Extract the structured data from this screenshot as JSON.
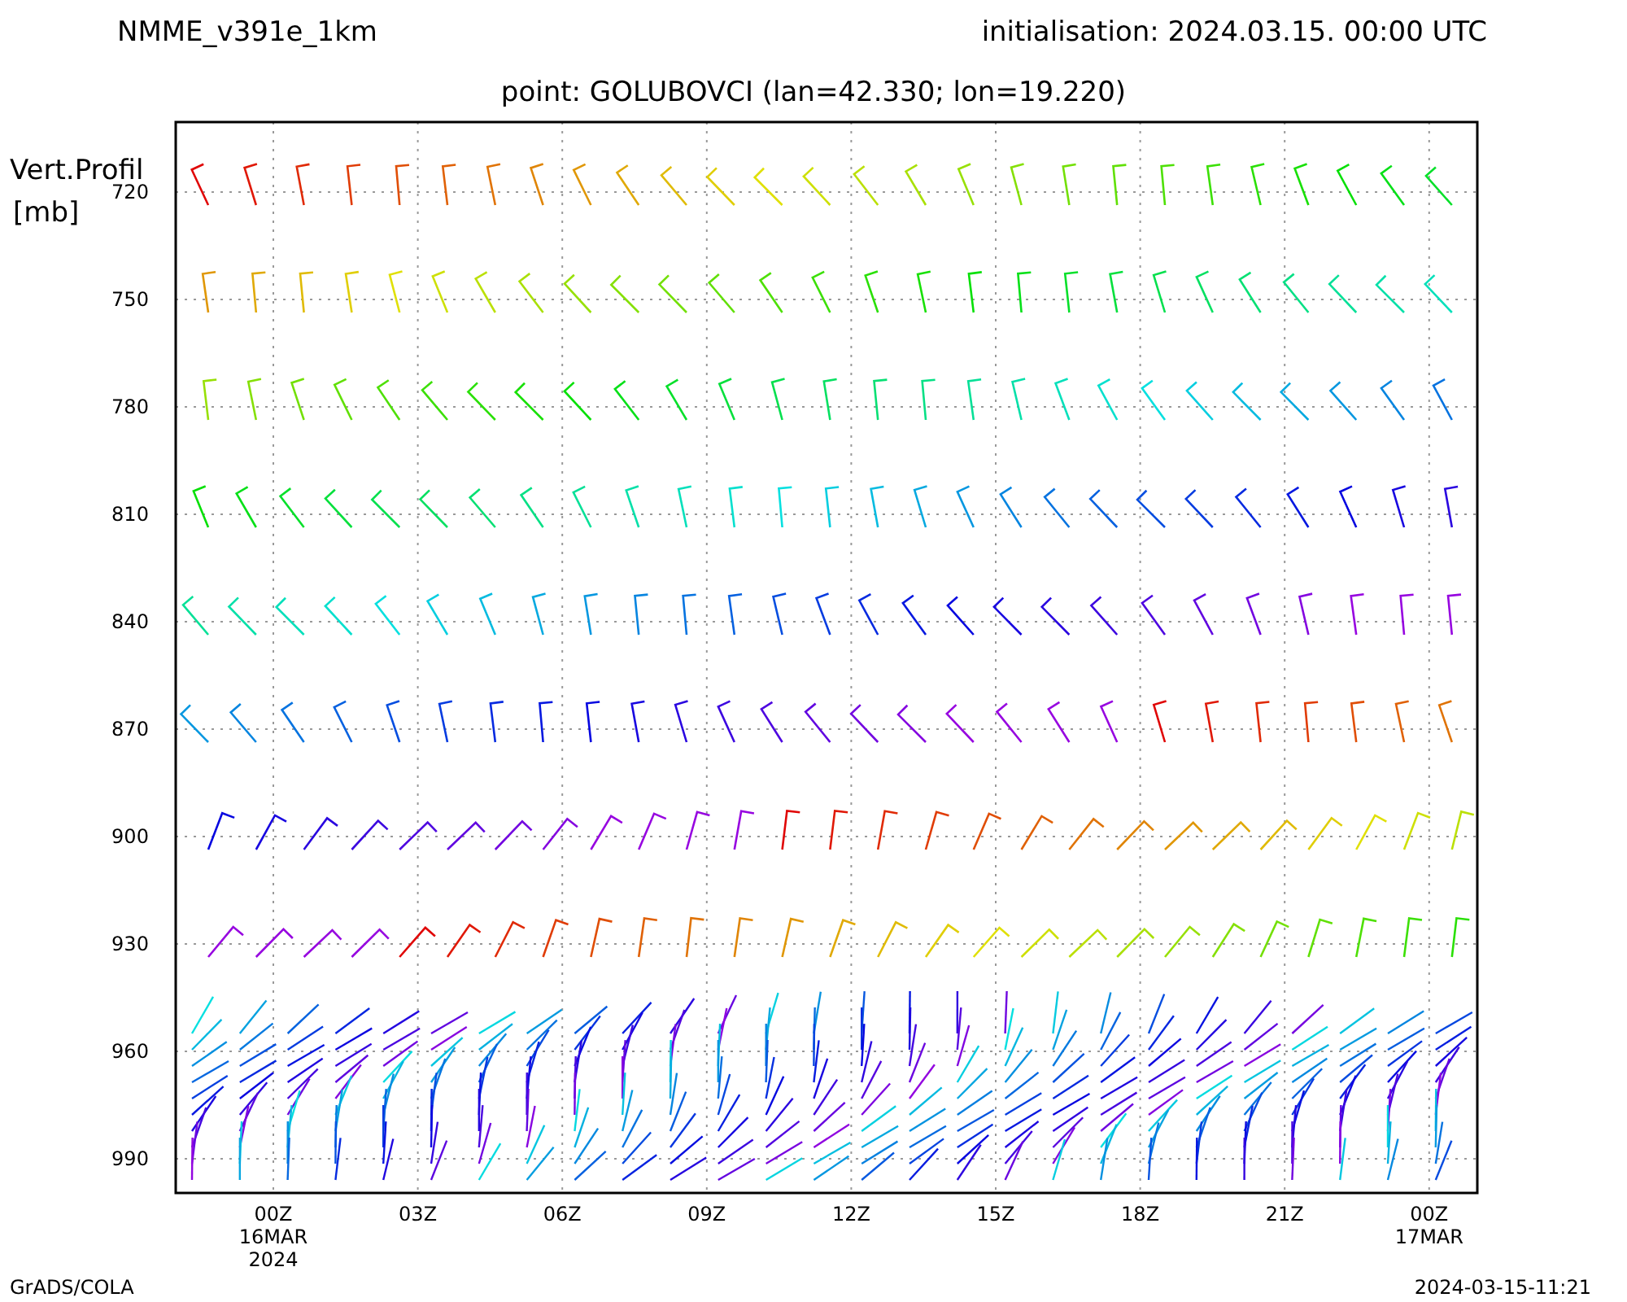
{
  "header": {
    "model": "NMME_v391e_1km",
    "initialisation": "initialisation: 2024.03.15. 00:00 UTC"
  },
  "subtitle": "point: GOLUBOVCI (lan=42.330; lon=19.220)",
  "y_axis": {
    "title_lines": [
      "Vert.Profil",
      "[mb]"
    ],
    "ticks": [
      "720",
      "750",
      "780",
      "810",
      "840",
      "870",
      "900",
      "930",
      "960",
      "990"
    ]
  },
  "x_axis": {
    "ticks": [
      {
        "label": "00Z",
        "lines": [
          "16MAR",
          "2024"
        ]
      },
      {
        "label": "03Z"
      },
      {
        "label": "06Z"
      },
      {
        "label": "09Z"
      },
      {
        "label": "12Z"
      },
      {
        "label": "15Z"
      },
      {
        "label": "18Z"
      },
      {
        "label": "21Z"
      },
      {
        "label": "00Z",
        "lines": [
          "17MAR"
        ]
      }
    ]
  },
  "footer": {
    "left": "GrADS/COLA",
    "right": "2024-03-15-11:21"
  }
}
